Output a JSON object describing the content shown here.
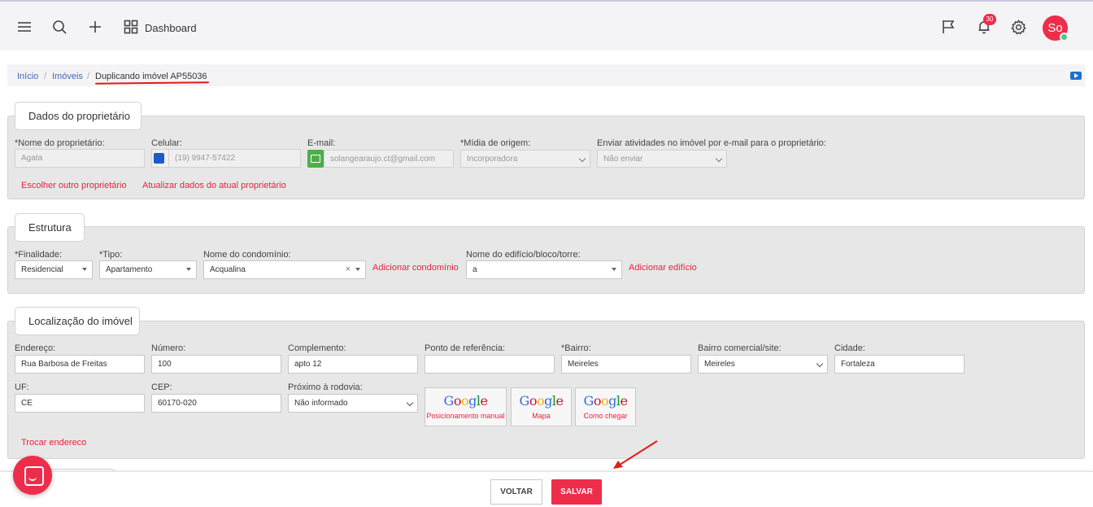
{
  "topbar": {
    "dashboard_label": "Dashboard",
    "notification_count": "30",
    "avatar_initials": "So",
    "icons": [
      "menu-icon",
      "search-icon",
      "plus-icon",
      "grid-icon",
      "flag-icon",
      "bell-icon",
      "gear-icon"
    ]
  },
  "breadcrumb": {
    "home": "Início",
    "sep1": "/",
    "properties": "Imóveis",
    "sep2": "/",
    "current": "Duplicando imóvel AP55036"
  },
  "owner": {
    "title": "Dados do proprietário",
    "name_label": "*Nome do proprietário:",
    "name_value": "Agata",
    "phone_label": "Celular:",
    "phone_value": "(19) 9947-57422",
    "email_label": "E-mail:",
    "email_value": "solangearaujo.ct@gmail.com",
    "media_label": "*Mídia de origem:",
    "media_value": "Incorporadora",
    "send_label": "Enviar atividades no imóvel por e-mail para o proprietário:",
    "send_value": "Não enviar",
    "choose_other": "Escolher outro proprietário",
    "update_current": "Atualizar dados do atual proprietário"
  },
  "structure": {
    "title": "Estrutura",
    "purpose_label": "*Finalidade:",
    "purpose_value": "Residencial",
    "type_label": "*Tipo:",
    "type_value": "Apartamento",
    "condo_label": "Nome do condomínio:",
    "condo_value": "Acqualina",
    "add_condo": "Adicionar condomínio",
    "building_label": "Nome do edifício/bloco/torre:",
    "building_value": "a",
    "add_building": "Adicionar edifício"
  },
  "location": {
    "title": "Localização do imóvel",
    "address_label": "Endereço:",
    "address_value": "Rua Barbosa de Freitas",
    "number_label": "Número:",
    "number_value": "100",
    "complement_label": "Complemento:",
    "complement_value": "apto 12",
    "reference_label": "Ponto de referência:",
    "reference_value": "",
    "district_label": "*Bairro:",
    "district_value": "Meireles",
    "commercial_label": "Bairro comercial/site:",
    "commercial_value": "Meireles",
    "city_label": "Cidade:",
    "city_value": "Fortaleza",
    "uf_label": "UF:",
    "uf_value": "CE",
    "cep_label": "CEP:",
    "cep_value": "60170-020",
    "highway_label": "Próximo à rodovia:",
    "highway_value": "Não informado",
    "map_buttons": [
      {
        "logo": "Google",
        "caption": "Posicionamento manual"
      },
      {
        "logo": "Google",
        "caption": "Mapa"
      },
      {
        "logo": "Google",
        "caption": "Como chegar"
      }
    ],
    "change_address": "Trocar endereco"
  },
  "actions": {
    "back": "VOLTAR",
    "save": "SALVAR"
  },
  "colors": {
    "accent": "#ee2d4a",
    "link": "#3a6bb5",
    "panel": "#e7e7e8"
  }
}
